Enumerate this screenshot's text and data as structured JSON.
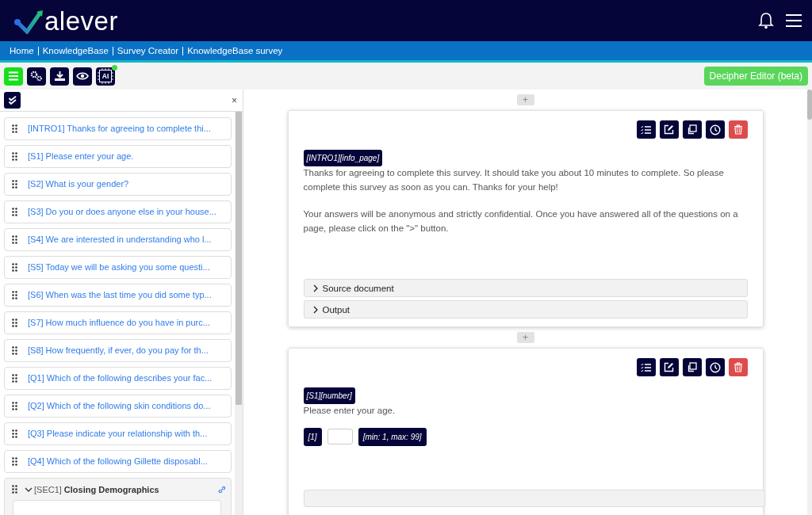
{
  "header": {
    "logo_text": "alever"
  },
  "breadcrumb": [
    {
      "label": "Home"
    },
    {
      "label": "KnowledgeBase"
    },
    {
      "label": "Survey Creator"
    },
    {
      "label": "KnowledgeBase survey"
    }
  ],
  "toolbar": [
    {
      "kind": "menu",
      "selected": true,
      "indicator": false
    },
    {
      "kind": "settings",
      "selected": false,
      "indicator": false
    },
    {
      "kind": "download",
      "selected": false,
      "indicator": false
    },
    {
      "kind": "preview",
      "selected": false,
      "indicator": false
    },
    {
      "kind": "ai",
      "label": "AI",
      "selected": false,
      "indicator": true
    }
  ],
  "editor_button": "Decipher Editor (beta)",
  "sidebar": {
    "close": "×",
    "items": [
      {
        "kind": "question",
        "text": "[INTRO1] Thanks for agreeing to complete thi..."
      },
      {
        "kind": "question",
        "text": "[S1] Please enter your age."
      },
      {
        "kind": "question",
        "text": "[S2] What is your gender?"
      },
      {
        "kind": "question",
        "text": "[S3] Do you or does anyone else in your house..."
      },
      {
        "kind": "question",
        "text": "[S4] We are interested in understanding who l..."
      },
      {
        "kind": "question",
        "text": "[S5] Today we will be asking you some questi..."
      },
      {
        "kind": "question",
        "text": "[S6] When was the last time you did some typ..."
      },
      {
        "kind": "question",
        "text": "[S7] How much influence do you have in purc..."
      },
      {
        "kind": "question",
        "text": "[S8] How frequently, if ever, do you pay for th..."
      },
      {
        "kind": "question",
        "text": "[Q1] Which of the following describes your fac..."
      },
      {
        "kind": "question",
        "text": "[Q2] Which of the following skin conditions do..."
      },
      {
        "kind": "question",
        "text": "[Q3] Please indicate your relationship with th..."
      },
      {
        "kind": "question",
        "text": "[Q4] Which of the following Gillette disposabl..."
      },
      {
        "kind": "section",
        "code": "[SEC1]",
        "title": "Closing Demographics",
        "expanded": true
      }
    ]
  },
  "add_label": "+",
  "cards": [
    {
      "kind": "info",
      "tag": "[INTRO1][info_page]",
      "paragraphs": [
        "Thanks for agreeing to complete this survey. It should take you about 10 minutes to complete. So please complete this survey as soon as you can. Thanks for your help!",
        "Your answers will be anonymous and strictly confidential. Once you have answered all of the questions on a page, please click on the \">\" button."
      ],
      "panels": [
        {
          "label": "Source document",
          "expanded": false
        },
        {
          "label": "Output",
          "expanded": false
        }
      ]
    },
    {
      "kind": "number",
      "tag": "[S1][number]",
      "paragraphs": [
        "Please enter your age."
      ],
      "field": {
        "index": "[1]",
        "range": "[min: 1, max: 99]"
      }
    }
  ]
}
